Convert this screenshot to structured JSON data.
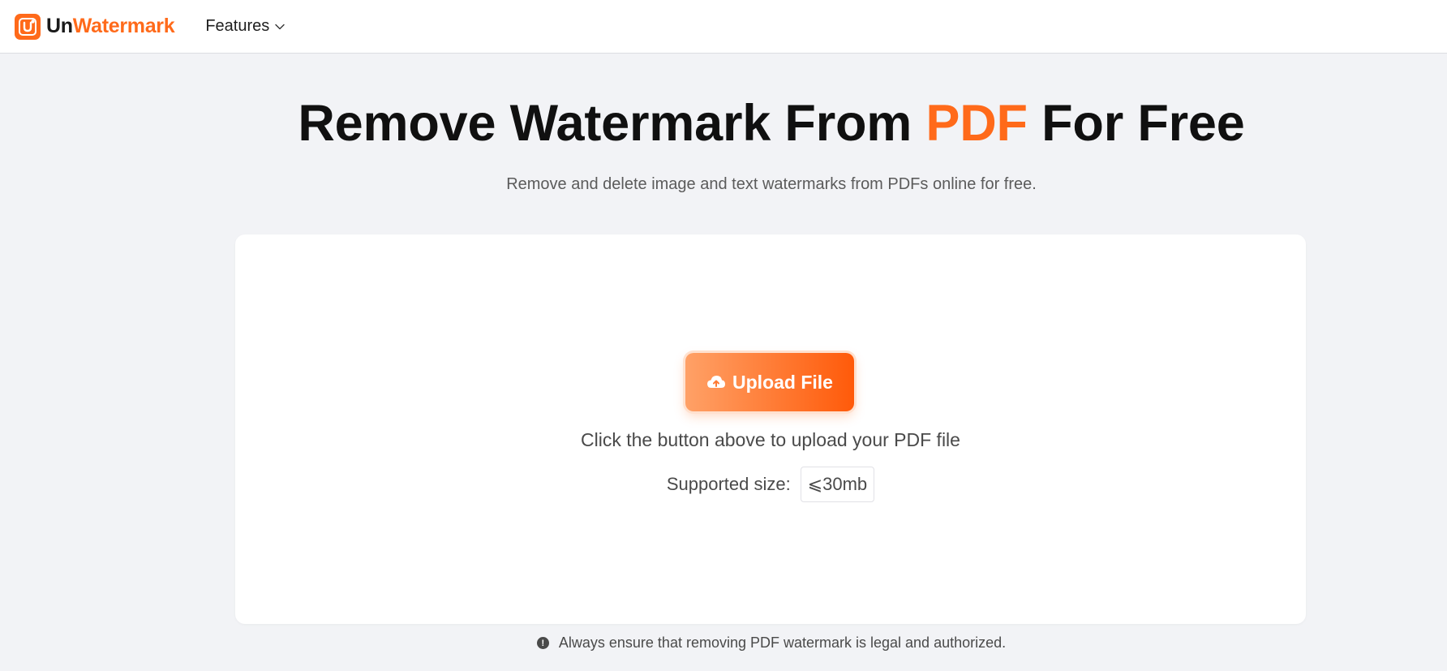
{
  "header": {
    "logo_text_un": "Un",
    "logo_text_watermark": "Watermark",
    "logo_icon": "unwatermark-logo-icon",
    "nav_features_label": "Features",
    "brand_color": "#ff6a1a"
  },
  "hero": {
    "title_part1": "Remove Watermark From ",
    "title_accent": "PDF",
    "title_part2": " For Free",
    "subtitle": "Remove and delete image and text watermarks from PDFs online for free."
  },
  "upload": {
    "button_label": "Upload File",
    "button_icon": "cloud-upload-icon",
    "hint": "Click the button above to upload your PDF file",
    "size_label": "Supported size:",
    "size_value": "⩽30mb"
  },
  "notice": {
    "icon": "info-icon",
    "text": "Always ensure that removing PDF watermark is legal and authorized."
  }
}
